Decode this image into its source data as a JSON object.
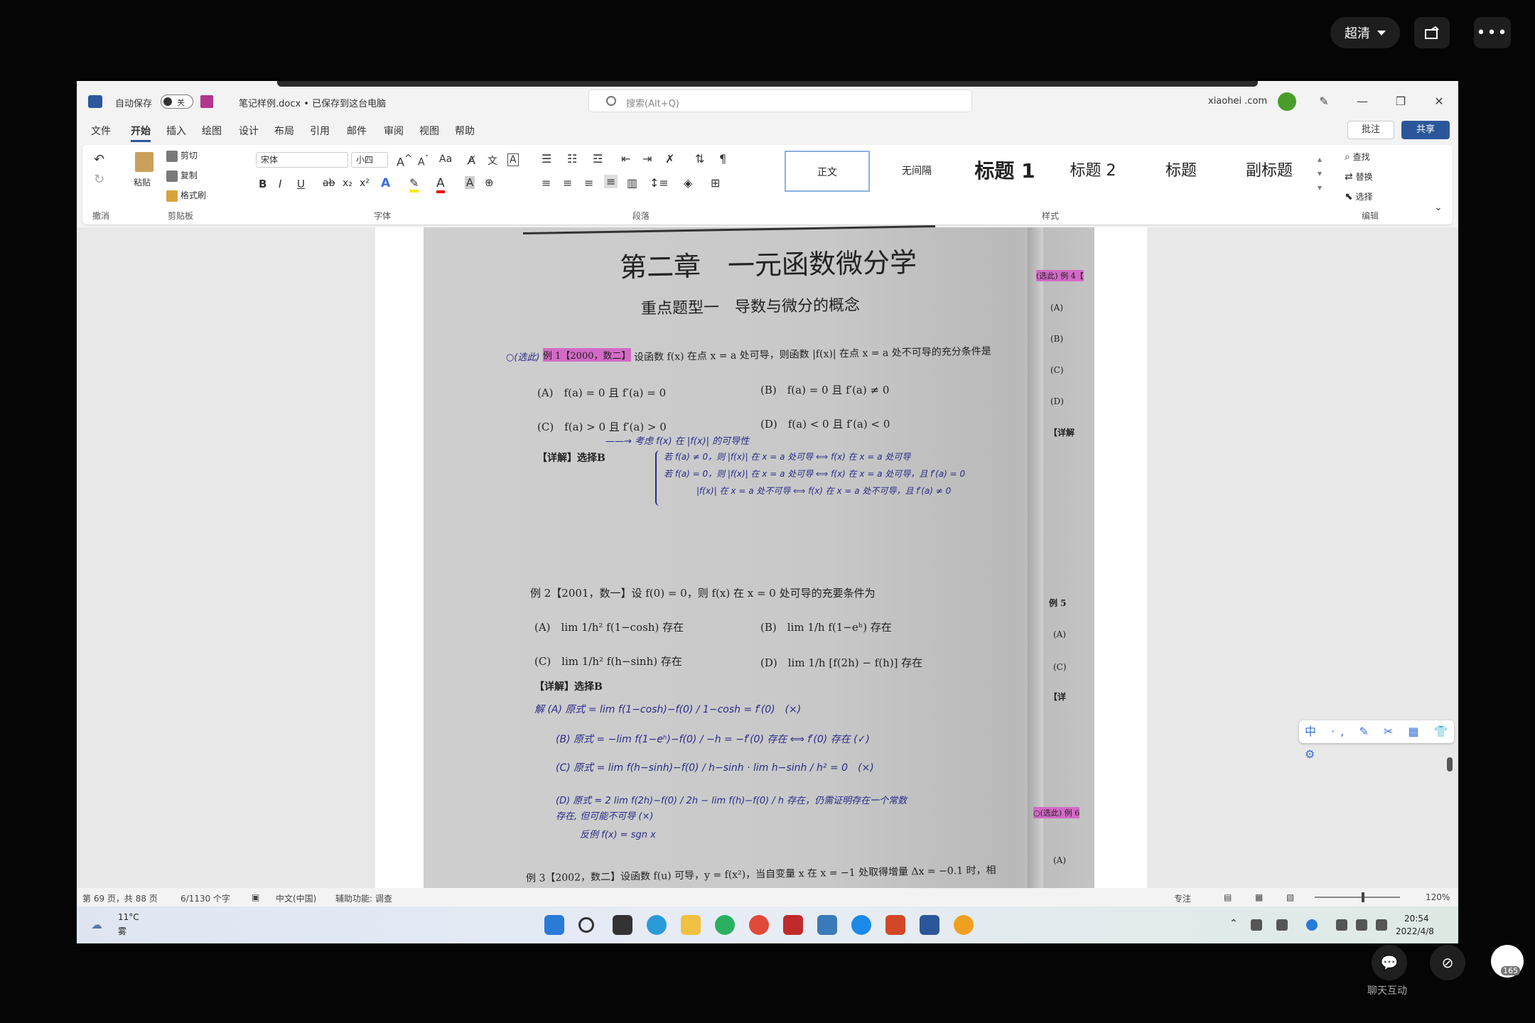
{
  "player": {
    "quality": "超清",
    "more": "•••"
  },
  "titlebar": {
    "autosave": "自动保存",
    "autosave_state": "关",
    "doc_title": "笔记样例.docx • 已保存到这台电脑",
    "search_placeholder": "搜索(Alt+Q)",
    "account": "xiaohei .com",
    "minimize": "—",
    "restore": "❐",
    "close": "✕"
  },
  "menu": {
    "tabs": [
      "文件",
      "开始",
      "插入",
      "绘图",
      "设计",
      "布局",
      "引用",
      "邮件",
      "审阅",
      "视图",
      "帮助"
    ],
    "active": "开始",
    "comment": "批注",
    "share": "共享"
  },
  "ribbon": {
    "undo_label": "撤消",
    "clipboard": {
      "paste": "粘贴",
      "cut": "剪切",
      "copy": "复制",
      "format_painter": "格式刷",
      "label": "剪贴板"
    },
    "font": {
      "name": "宋体",
      "size": "小四",
      "label": "字体",
      "bold": "B",
      "italic": "I",
      "underline": "U"
    },
    "paragraph": {
      "label": "段落"
    },
    "styles": {
      "items": [
        "正文",
        "无间隔",
        "标题 1",
        "标题 2",
        "标题",
        "副标题"
      ],
      "label": "样式"
    },
    "editing": {
      "find": "查找",
      "replace": "替换",
      "select": "选择",
      "label": "编辑"
    }
  },
  "document": {
    "chapter_title": "第二章　一元函数微分学",
    "section_title": "重点题型一　导数与微分的概念",
    "ex1": {
      "tag": "例 1【2000，数二】",
      "prefix": "○(选此)",
      "question": "设函数 f(x) 在点 x = a 处可导，则函数 |f(x)| 在点 x = a 处不可导的充分条件是",
      "opt_a": "(A)　f(a) = 0 且 f′(a) = 0",
      "opt_b": "(B)　f(a) = 0 且 f′(a) ≠ 0",
      "opt_c": "(C)　f(a) > 0 且 f′(a) > 0",
      "opt_d": "(D)　f(a) < 0 且 f′(a) < 0",
      "answer": "【详解】选择B",
      "note1": "——→ 考虑 f(x) 在 |f(x)| 的可导性",
      "note2": "若 f(a) ≠ 0，则 |f(x)| 在 x = a 处可导 ⟺ f(x) 在 x = a 处可导",
      "note3": "若 f(a) = 0，则 |f(x)| 在 x = a 处可导 ⟺ f(x) 在 x = a 处可导，且 f′(a) = 0",
      "note4": "|f(x)| 在 x = a 处不可导 ⟺ f(x) 在 x = a 处不可导，且 f′(a) ≠ 0"
    },
    "ex2": {
      "question": "例 2【2001，数一】设 f(0) = 0，则 f(x) 在 x = 0 处可导的充要条件为",
      "opt_a": "(A)　lim 1/h² f(1−cosh) 存在",
      "opt_b": "(B)　lim 1/h f(1−eʰ) 存在",
      "opt_c": "(C)　lim 1/h² f(h−sinh) 存在",
      "opt_d": "(D)　lim 1/h [f(2h) − f(h)] 存在",
      "answer": "【详解】选择B",
      "w1": "解 (A) 原式 = lim f(1−cosh)−f(0) / 1−cosh = f′(0)　(×)",
      "w2": "(B) 原式 = −lim f(1−eʰ)−f(0) / −h = −f′(0) 存在 ⟺ f′(0) 存在 (✓)",
      "w3": "(C) 原式 = lim f(h−sinh)−f(0) / h−sinh · lim h−sinh / h² = 0　(×)",
      "w4": "(D) 原式 = 2 lim f(2h)−f(0) / 2h − lim f(h)−f(0) / h 存在，仍需证明存在一个常数",
      "w5": "反例 f(x) = sgn x",
      "w6": "存在, 但可能不可导 (×)"
    },
    "ex3": {
      "question": "例 3【2002，数二】设函数 f(u) 可导，y = f(x²)，当自变量 x 在 x = −1 处取得增量 Δx = −0.1 时，相"
    },
    "right_margin": [
      "(选此) 例 4【",
      "(A)",
      "(B)",
      "(C)",
      "(D)",
      "【详解",
      "例 5",
      "(A)",
      "(C)",
      "【详",
      "○(选此) 例 6",
      "(A)"
    ]
  },
  "ime": {
    "label": "中 ·,  ✎  ✂  ▦  👕  ⚙"
  },
  "status": {
    "page": "第 69 页，共 88 页",
    "words": "6/1130 个字",
    "language": "中文(中国)",
    "accessibility": "辅助功能: 调查",
    "focus": "专注",
    "zoom": "120%"
  },
  "taskbar": {
    "weather_temp": "11°C",
    "weather_desc": "雾",
    "time": "20:54",
    "date": "2022/4/8",
    "apps": [
      "start-icon",
      "search-icon",
      "taskview-icon",
      "edge-icon",
      "explorer-icon",
      "wechat-icon",
      "chrome-icon",
      "media-icon",
      "photos-icon",
      "app-icon",
      "powerpoint-icon",
      "word-icon",
      "app2-icon"
    ]
  },
  "side": {
    "chat_label": "聊天互动",
    "badge_count": "165"
  }
}
